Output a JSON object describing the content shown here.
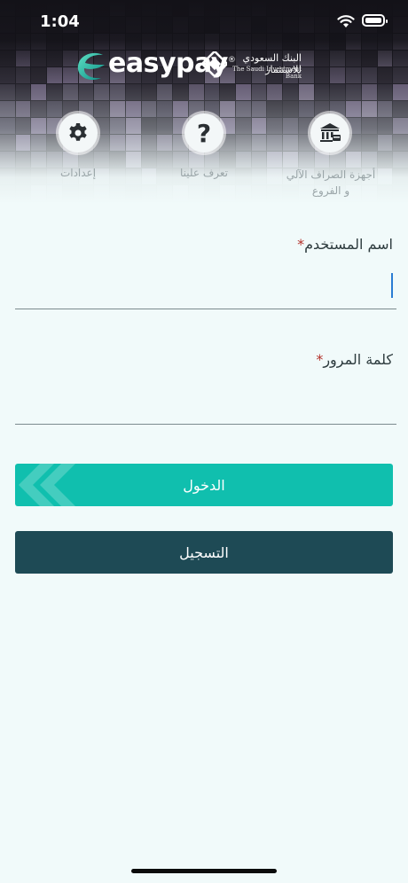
{
  "status_bar": {
    "time": "1:04"
  },
  "header": {
    "brand": "easypay",
    "brand_mark": "®",
    "bank_name_ar": "البنك السعودي للاستثمار",
    "bank_name_en": "The Saudi Investment Bank"
  },
  "quick_actions": [
    {
      "label": "أجهزة الصراف الآلي و الفروع",
      "icon": "bank-icon"
    },
    {
      "label": "تعرف علينا",
      "icon": "question-icon"
    },
    {
      "label": "إعدادات",
      "icon": "gear-icon"
    }
  ],
  "form": {
    "username_label": "اسم المستخدم",
    "username_value": "",
    "password_label": "كلمة المرور",
    "password_value": "",
    "required_mark": "*"
  },
  "buttons": {
    "login": "الدخول",
    "register": "التسجيل"
  },
  "colors": {
    "accent": "#10bfae",
    "dark": "#1e4a55",
    "background": "#f1fafa",
    "required": "#b3312a"
  }
}
